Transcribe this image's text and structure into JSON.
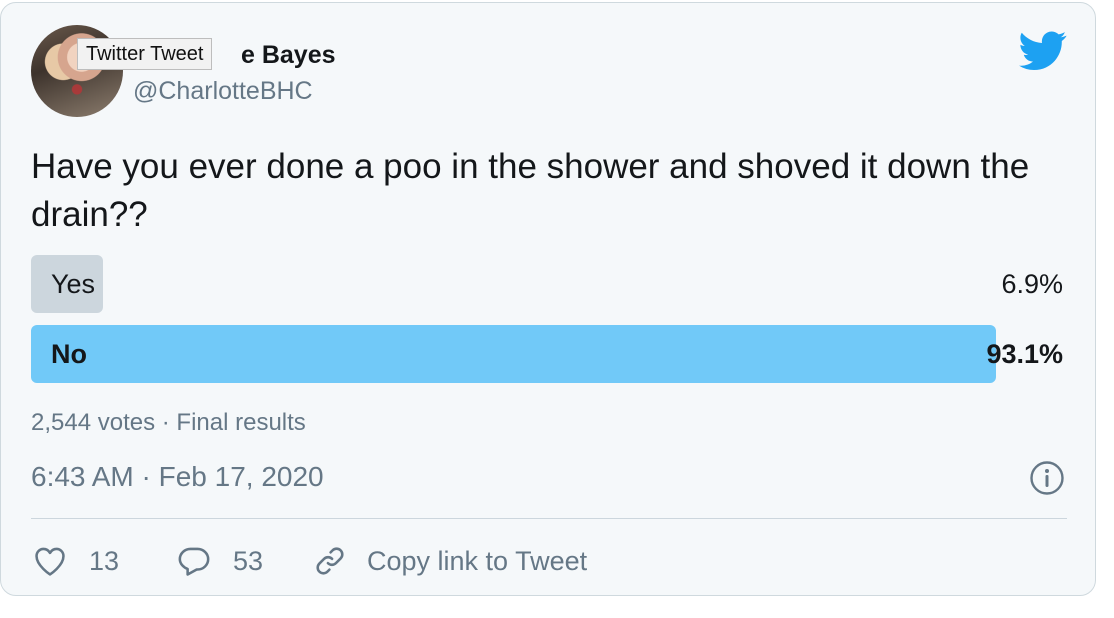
{
  "tweet": {
    "author": {
      "display_name_visible": "e Bayes",
      "username": "@CharlotteBHC"
    },
    "tooltip": "Twitter Tweet",
    "text": "Have you ever done a poo in the shower and shoved it down the drain??",
    "poll": {
      "options": [
        {
          "label": "Yes",
          "percent_text": "6.9%",
          "percent": 6.9,
          "winner": false
        },
        {
          "label": "No",
          "percent_text": "93.1%",
          "percent": 93.1,
          "winner": true
        }
      ],
      "summary": "2,544 votes · Final results"
    },
    "timestamp": "6:43 AM · Feb 17, 2020",
    "actions": {
      "likes": "13",
      "replies": "53",
      "copy_link": "Copy link to Tweet"
    }
  },
  "colors": {
    "accent": "#1da1f2",
    "winner_bar": "#71c9f8",
    "loser_bar": "#ccd6dd",
    "muted_text": "#657786"
  },
  "icons": [
    "twitter-bird-icon",
    "info-icon",
    "heart-icon",
    "reply-icon",
    "link-icon"
  ]
}
